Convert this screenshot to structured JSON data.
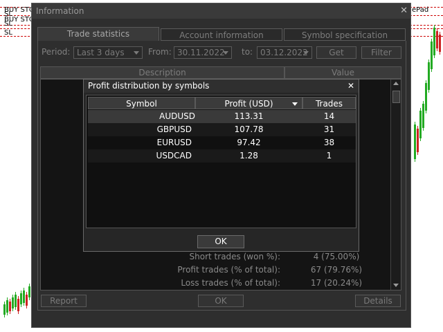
{
  "background_chart": {
    "labels": [
      "BUY STOP",
      "SL",
      "BUY STOP",
      "SL",
      "SL",
      "ePad"
    ]
  },
  "dialog": {
    "title": "Information",
    "tabs": [
      "Trade statistics",
      "Account information",
      "Symbol specification"
    ],
    "period_label": "Period:",
    "period_value": "Last 3 days",
    "from_label": "From:",
    "from_value": "30.11.2022",
    "to_label": "to:",
    "to_value": "03.12.2022",
    "get_label": "Get",
    "filter_label": "Filter",
    "columns": [
      "Description",
      "Value"
    ],
    "rows": [
      {
        "label": "Short trades (won %):",
        "value": "4 (75.00%)"
      },
      {
        "label": "Profit trades (% of total):",
        "value": "67 (79.76%)"
      },
      {
        "label": "Loss trades (% of total):",
        "value": "17 (20.24%)"
      }
    ],
    "report_label": "Report",
    "ok_label": "OK",
    "details_label": "Details"
  },
  "popup": {
    "title": "Profit distribution by symbols",
    "columns": [
      "Symbol",
      "Profit (USD)",
      "Trades"
    ],
    "rows": [
      {
        "symbol": "AUDUSD",
        "profit": "113.31",
        "trades": "14"
      },
      {
        "symbol": "GBPUSD",
        "profit": "107.78",
        "trades": "31"
      },
      {
        "symbol": "EURUSD",
        "profit": "97.42",
        "trades": "38"
      },
      {
        "symbol": "USDCAD",
        "profit": "1.28",
        "trades": "1"
      }
    ],
    "ok_label": "OK"
  },
  "colors": {
    "dialog_bg": "#2e2e2e",
    "popup_bg": "#262626",
    "selected_row": "#3a3a3a",
    "candle_green": "#22aa22",
    "candle_red": "#cc2222"
  }
}
